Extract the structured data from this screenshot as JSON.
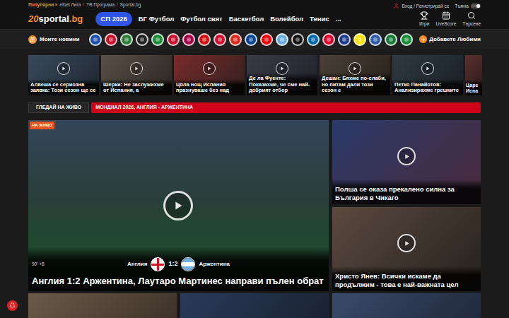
{
  "header": {
    "popular_label": "Популярни »",
    "popular_links": [
      "efbet Лига",
      "ТВ Програма",
      "Sportal.bg"
    ],
    "login": "Вход / Регистрирай се",
    "theme": {
      "label": "Тъмна",
      "on": true
    },
    "logo": {
      "badge": "20",
      "name": "sportal",
      "suffix": ".bg"
    }
  },
  "nav": [
    {
      "label": "СП 2026",
      "selected": true
    },
    {
      "label": "БГ Футбол",
      "selected": false
    },
    {
      "label": "Футбол свят",
      "selected": false
    },
    {
      "label": "Баскетбол",
      "selected": false
    },
    {
      "label": "Волейбол",
      "selected": false
    },
    {
      "label": "Тенис",
      "selected": false
    },
    {
      "label": "...",
      "selected": false
    }
  ],
  "tools": [
    "Игри",
    "LiveScore",
    "Търсене"
  ],
  "favorites": {
    "label": "Моите новини",
    "add": "Добавете Любими",
    "teams": [
      {
        "color": "#1e4fa8"
      },
      {
        "color": "#c8102e"
      },
      {
        "color": "#2b7d3a"
      },
      {
        "color": "#222222"
      },
      {
        "color": "#1a8a3a"
      },
      {
        "color": "#c8102e"
      },
      {
        "color": "#a50044"
      },
      {
        "color": "#d01010"
      },
      {
        "color": "#c8102e"
      },
      {
        "color": "#da291c"
      },
      {
        "color": "#034694"
      },
      {
        "color": "#ef0107"
      },
      {
        "color": "#6cabdd"
      },
      {
        "color": "#111111"
      },
      {
        "color": "#0068a8"
      },
      {
        "color": "#dc052d"
      },
      {
        "color": "#1e3c8c"
      },
      {
        "color": "#fde100"
      },
      {
        "color": "#2e5aa8"
      },
      {
        "color": "#1a7a3a"
      },
      {
        "color": "#1a8a3a"
      }
    ]
  },
  "thumbnails": [
    {
      "title": "Алвеша се сериозна заявка: Този сезон ще се"
    },
    {
      "title": "Шерки: Не заслужихме от Испания, а"
    },
    {
      "title": "Цяла нощ Испания празнуваше без над"
    },
    {
      "title": "Де ла Фуенте: Показахме, че сме най-добрият отбор"
    },
    {
      "title": "Дешан: Бяхме по-слаби, но питам дали този сезон е"
    },
    {
      "title": "Петко Панайотов: Анализирахме грешките"
    },
    {
      "title": "Царе Испа"
    }
  ],
  "live_bar": {
    "label": "ГЛЕДАЙ НА ЖИВО",
    "event": "МОНДИАЛ 2026, АНГЛИЯ - АРЖЕНТИНА"
  },
  "featured": {
    "badge": "НА ЖИВО",
    "minute": "90' +8",
    "home": "Англия",
    "score": "1:2",
    "away": "Аржентина",
    "title": "Англия 1:2 Аржентина, Лаутаро Мартинес направи пълен обрат"
  },
  "side_stories": [
    {
      "title": "Полша се оказа прекалено силна за България в Чикаго"
    },
    {
      "title": "Христо Янев: Всички искаме да продължим - това е най-важната цел"
    }
  ]
}
